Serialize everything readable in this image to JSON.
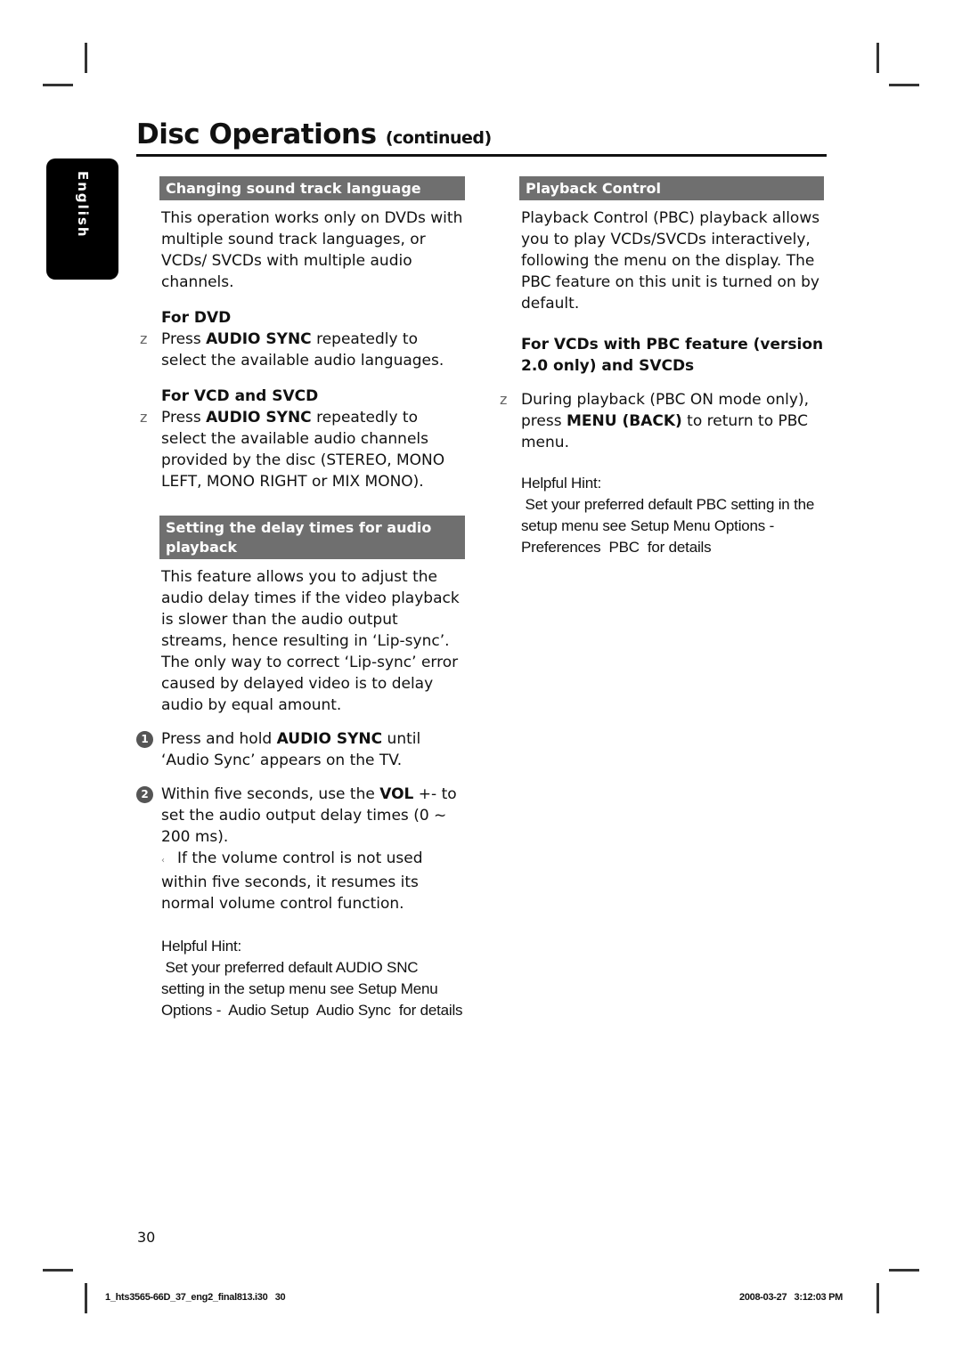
{
  "header": {
    "title": "Disc Operations",
    "title_suffix": "(continued)"
  },
  "language_tab": "English",
  "left_column": {
    "section1": {
      "heading": "Changing sound track language",
      "intro": "This operation works only on DVDs with multiple sound track languages, or VCDs/ SVCDs with multiple audio channels.",
      "for_dvd": {
        "label": "For DVD",
        "bullet_marker": "z",
        "pre": "Press ",
        "key": "AUDIO SYNC",
        "post": " repeatedly to select the available audio languages."
      },
      "for_vcd": {
        "label": "For VCD and SVCD",
        "bullet_marker": "z",
        "pre": "Press ",
        "key": "AUDIO SYNC",
        "post": " repeatedly to select the available audio channels provided by the disc (STEREO, MONO LEFT, MONO RIGHT or MIX MONO)."
      }
    },
    "section2": {
      "heading": "Setting the delay times for audio playback",
      "intro": "This feature allows you to adjust the audio delay times if the video playback is slower than the audio output streams, hence resulting in ‘Lip-sync’. The only way to correct ‘Lip-sync’ error caused by delayed video is to delay audio by equal amount.",
      "steps": [
        {
          "num": "1",
          "pre": "Press and hold ",
          "key": "AUDIO SYNC",
          "post": " until ‘Audio Sync’ appears on the TV."
        },
        {
          "num": "2",
          "pre": "Within five seconds, use the ",
          "key": "VOL",
          "post": " +- to set the audio output delay times (0 ~ 200 ms)."
        }
      ],
      "note_marker": "‹",
      "note": "If the volume control is not used within five seconds, it resumes its normal volume control function.",
      "hint_label": "Helpful Hint:",
      "hint_text": " Set your preferred default AUDIO SNC setting in the setup menu see Setup Menu Options -  Audio Setup  Audio Sync  for details"
    }
  },
  "right_column": {
    "heading": "Playback Control",
    "intro": "Playback Control (PBC) playback allows you to play VCDs/SVCDs interactively, following the menu on the display. The PBC feature on this unit is turned on by default.",
    "sub_heading": "For VCDs with PBC feature (version 2.0 only) and SVCDs",
    "bullet_marker": "z",
    "bullet_pre": "During playback (PBC ON mode only), press ",
    "bullet_key": "MENU (BACK)",
    "bullet_post": " to return to PBC menu.",
    "hint_label": "Helpful Hint:",
    "hint_text": " Set your preferred default PBC setting in the setup menu see Setup Menu Options -  Preferences  PBC  for details"
  },
  "footer": {
    "page_number": "30",
    "file_info": "1_hts3565-66D_37_eng2_final813.i30   30",
    "timestamp": "2008-03-27   3:12:03 PM"
  }
}
